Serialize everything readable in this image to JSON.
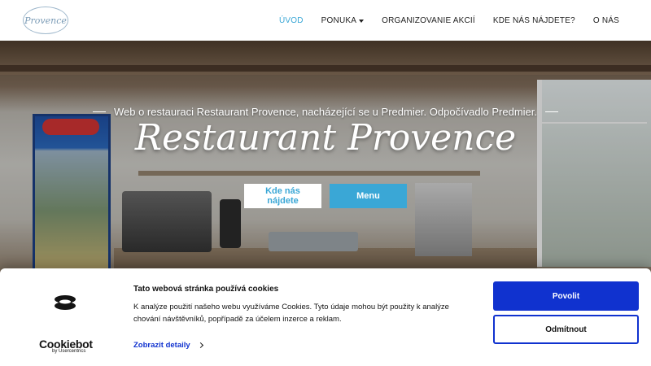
{
  "logo": {
    "text": "Provence"
  },
  "nav": {
    "items": [
      {
        "label": "ÚVOD",
        "active": true
      },
      {
        "label": "PONUKA",
        "has_dropdown": true
      },
      {
        "label": "ORGANIZOVANIE AKCIÍ"
      },
      {
        "label": "KDE NÁS NÁJDETE?"
      },
      {
        "label": "O NÁS"
      }
    ]
  },
  "hero": {
    "subtitle": "Web o restauraci Restaurant Provence, nacházející se u Predmier. Odpočívadlo Predmier.",
    "title": "Restaurant Provence",
    "buttons": {
      "location": "Kde nás nájdete",
      "menu": "Menu"
    }
  },
  "cookie_banner": {
    "title": "Tato webová stránka používá cookies",
    "text": "K analýze použití našeho webu využíváme Cookies. Tyto údaje mohou být použity k analýze chování návštěvníků, popřípadě za účelem inzerce a reklam.",
    "details_link": "Zobrazit detaily",
    "allow_button": "Povolit",
    "deny_button": "Odmítnout",
    "brand": "Cookiebot",
    "brand_by": "by Usercentrics"
  },
  "colors": {
    "accent": "#3aa7d6",
    "cookie_blue": "#1032cf"
  }
}
